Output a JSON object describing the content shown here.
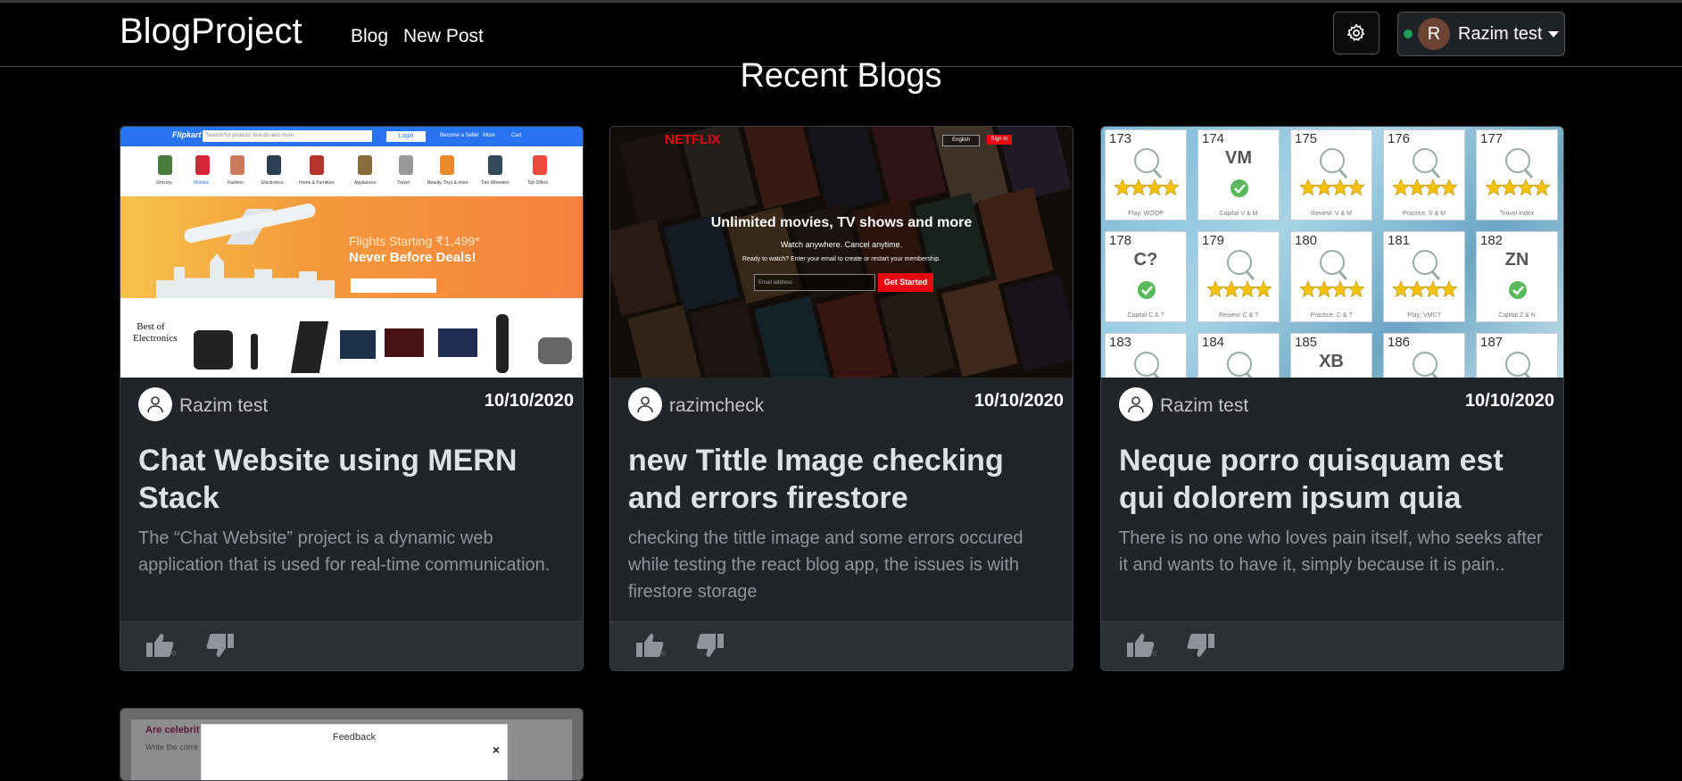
{
  "navbar": {
    "brand": "BlogProject",
    "links": [
      "Blog",
      "New Post"
    ],
    "user": {
      "initial": "R",
      "name": "Razim test",
      "status_color": "#1e9e57"
    }
  },
  "section_title": "Recent Blogs",
  "cards": [
    {
      "author": "Razim test",
      "date": "10/10/2020",
      "title": "Chat Website using MERN Stack",
      "description": "The “Chat Website” project is a dynamic web application that is used for real-time communication."
    },
    {
      "author": "razimcheck",
      "date": "10/10/2020",
      "title": "new Tittle Image checking and errors firestore",
      "description": "checking the tittle image and some errors occured while testing the react blog app, the issues is with firestore storage"
    },
    {
      "author": "Razim test",
      "date": "10/10/2020",
      "title": "Neque porro quisquam est qui dolorem ipsum quia",
      "description": "There is no one who loves pain itself, who seeks after it and wants to have it, simply because it is pain.."
    }
  ],
  "thumb1": {
    "logo": "Flipkart",
    "search_placeholder": "Search for product, brands and more",
    "login": "Login",
    "seller": "Become a Seller",
    "more": "More",
    "cart": "Cart",
    "categories": [
      "Grocery",
      "Mobiles",
      "Fashion",
      "Electronics",
      "Home & Furniture",
      "Appliances",
      "Travel",
      "Beauty, Toys & more",
      "Two Wheelers",
      "Top Offers"
    ],
    "banner_line1": "Flights Starting ₹1,499*",
    "banner_line2": "Never Before Deals!",
    "best_of": "Best of Electronics"
  },
  "thumb2": {
    "logo": "NETFLIX",
    "lang": "English",
    "signin": "Sign In",
    "headline": "Unlimited movies, TV shows and more",
    "sub1": "Watch anywhere. Cancel anytime.",
    "sub2": "Ready to watch? Enter your email to create or restart your membership.",
    "email_placeholder": "Email address",
    "cta": "Get Started"
  },
  "thumb3": {
    "tiles": [
      {
        "num": "173",
        "label": "Play: WOQP"
      },
      {
        "num": "174",
        "label": "Capital V & M",
        "text": "VM"
      },
      {
        "num": "175",
        "label": "Review: V & M"
      },
      {
        "num": "176",
        "label": "Practice: V & M"
      },
      {
        "num": "177",
        "label": "Travel Index"
      },
      {
        "num": "178",
        "label": "Capital C & ?",
        "text": "C?"
      },
      {
        "num": "179",
        "label": "Review: C & ?"
      },
      {
        "num": "180",
        "label": "Practice: C & ?"
      },
      {
        "num": "181",
        "label": "Play: VMC?"
      },
      {
        "num": "182",
        "label": "Capital Z & N",
        "text": "ZN"
      },
      {
        "num": "183",
        "label": ""
      },
      {
        "num": "184",
        "label": ""
      },
      {
        "num": "185",
        "label": "",
        "text": "XB"
      },
      {
        "num": "186",
        "label": ""
      },
      {
        "num": "187",
        "label": ""
      }
    ]
  },
  "card4": {
    "heading": "Are celebrit",
    "sub": "Write the corre",
    "modal_title": "Feedback",
    "close": "×"
  },
  "colors": {
    "accent_red": "#e50914",
    "flipkart_blue": "#2874f0",
    "card_bg": "#212529"
  }
}
